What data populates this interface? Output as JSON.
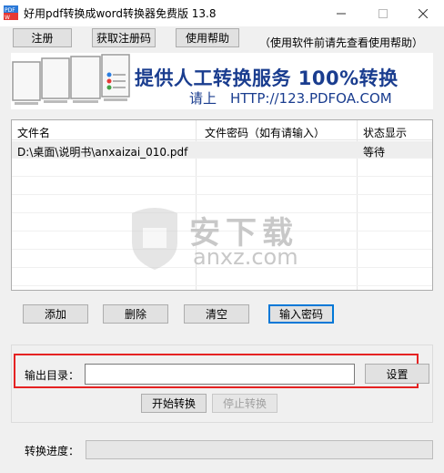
{
  "window": {
    "title": "好用pdf转换成word转换器免费版 13.8",
    "icon_name": "pdf-app-icon",
    "controls": [
      "minimize-icon",
      "maximize-icon",
      "close-icon"
    ]
  },
  "toolbar": {
    "register_label": "注册",
    "get_code_label": "获取注册码",
    "help_label": "使用帮助",
    "hint": "（使用软件前请先查看使用帮助）"
  },
  "banner": {
    "headline": "提供人工转换服务 100%转换",
    "link": "请上　HTTP://123.PDFOA.COM"
  },
  "file_list": {
    "columns": [
      "文件名",
      "文件密码（如有请输入）",
      "状态显示"
    ],
    "rows": [
      {
        "filename": "D:\\桌面\\说明书\\anxaizai_010.pdf",
        "password": "",
        "status": "等待"
      }
    ]
  },
  "watermark": {
    "title": "安下载",
    "subtitle": "anxz.com"
  },
  "actions": {
    "add_label": "添加",
    "delete_label": "删除",
    "clear_label": "清空",
    "password_label": "输入密码"
  },
  "output": {
    "dir_label": "输出目录：",
    "dir_value": "",
    "set_label": "设置",
    "start_label": "开始转换",
    "stop_label": "停止转换"
  },
  "progress": {
    "label": "转换进度：",
    "value": 0
  },
  "colors": {
    "banner_text": "#1a3d8f",
    "highlight": "#e52222",
    "default_button_border": "#0078d7"
  }
}
